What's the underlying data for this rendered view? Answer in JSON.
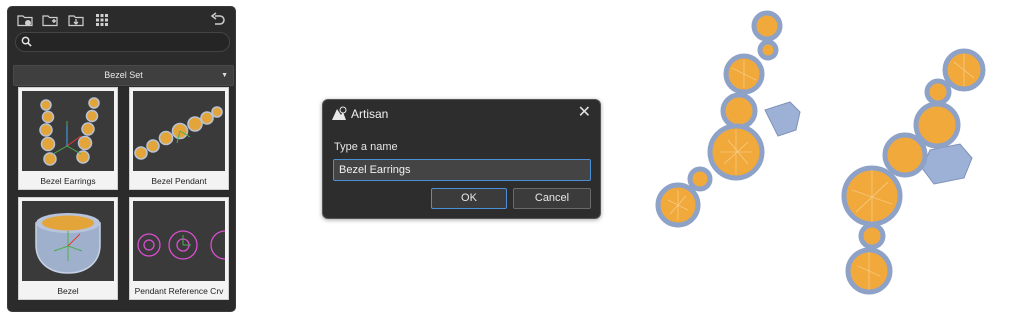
{
  "library": {
    "dropdown_value": "Bezel Set",
    "toolbar_icons": [
      "new-folder-icon",
      "add-folder-icon",
      "import-icon",
      "grid-view-icon",
      "undo-icon"
    ],
    "items": [
      {
        "label": "Bezel Earrings"
      },
      {
        "label": "Bezel Pendant"
      },
      {
        "label": "Bezel"
      },
      {
        "label": "Pendant Reference Crv"
      }
    ]
  },
  "dialog": {
    "title": "Artisan",
    "prompt": "Type a name",
    "input_value": "Bezel Earrings",
    "ok_label": "OK",
    "cancel_label": "Cancel"
  },
  "colors": {
    "gem": "#f2a93b",
    "metal": "#a9b9d6",
    "accent": "#4d8fd6"
  }
}
